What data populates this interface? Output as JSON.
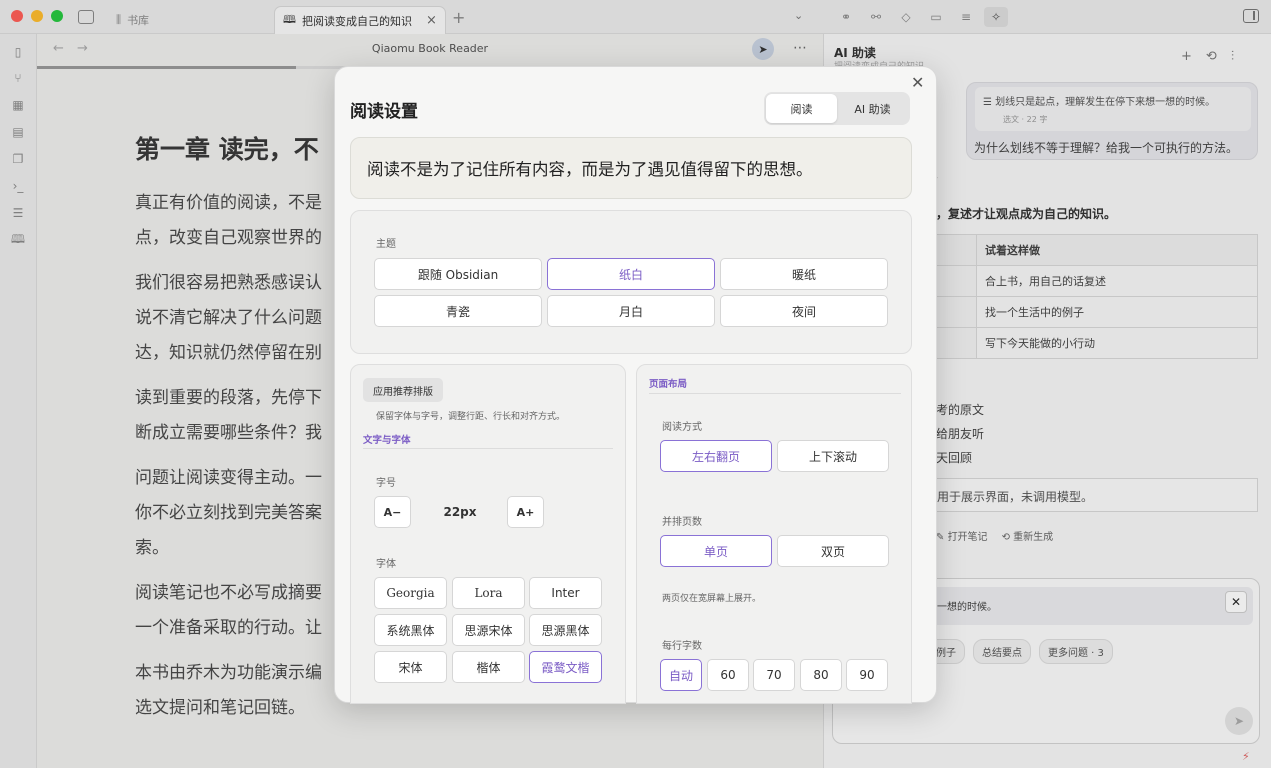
{
  "titlebar": {
    "tabs": [
      {
        "icon": "library-icon",
        "label": "书库",
        "active": false
      },
      {
        "icon": "book-open-icon",
        "label": "把阅读变成自己的知识",
        "active": true
      }
    ],
    "close_glyph": "×",
    "new_tab_glyph": "+"
  },
  "main": {
    "title": "Qiaomu Book Reader",
    "progress": 0.33,
    "chapter_title": "第一章 读完，不",
    "paragraphs": [
      "真正有价值的阅读，不是\n点，改变自己观察世界的",
      "我们很容易把熟悉感误认\n说不清它解决了什么问题\n达，知识就仍然停留在别",
      "读到重要的段落，先停下\n断成立需要哪些条件？我",
      "问题让阅读变得主动。一\n你不必立刻找到完美答案\n索。",
      "阅读笔记也不必写成摘要\n一个准备采取的行动。让",
      "本书由乔木为功能演示编\n选文提问和笔记回链。"
    ]
  },
  "ai_panel": {
    "title": "AI 助读",
    "subtitle": "把阅读变成自己的知识",
    "quote": {
      "text": "划线只是起点，理解发生在停下来想一想的时候。",
      "meta": "选文 · 22 字",
      "question": "为什么划线不等于理解？给我一个可执行的方法。"
    },
    "answer_tag": "”",
    "answer_lead": "，复述才让观点成为自己的知识。",
    "table": {
      "header": [
        "",
        "试着这样做"
      ],
      "rows": [
        [
          "",
          "合上书，用自己的话复述"
        ],
        [
          "",
          "找一个生活中的例子"
        ],
        [
          "",
          "写下今天能做的小行动"
        ]
      ]
    },
    "list": [
      "考的原文",
      "给朋友听",
      "天回顾"
    ],
    "note": "用于展示界面，未调用模型。",
    "actions": [
      "打开笔记",
      "重新生成"
    ],
    "composer": {
      "quote": "理解发生在停下来想一想的时候。",
      "chips": [
        "例子",
        "总结要点",
        "更多问题 · 3"
      ]
    }
  },
  "modal": {
    "title": "阅读设置",
    "mode_tabs": [
      {
        "label": "阅读",
        "selected": true
      },
      {
        "label": "AI 助读",
        "selected": false
      }
    ],
    "preview_text": "阅读不是为了记住所有内容，而是为了遇见值得留下的思想。",
    "theme": {
      "label": "主题",
      "options": [
        "跟随 Obsidian",
        "纸白",
        "暖纸",
        "青瓷",
        "月白",
        "夜间"
      ],
      "selected": "纸白"
    },
    "typography": {
      "apply_button": "应用推荐排版",
      "apply_hint": "保留字体与字号，调整行距、行长和对齐方式。",
      "section": "文字与字体",
      "size_label": "字号",
      "decrease": "A−",
      "size_value": "22px",
      "increase": "A+",
      "font_label": "字体",
      "fonts": [
        "Georgia",
        "Lora",
        "Inter",
        "系统黑体",
        "思源宋体",
        "思源黑体",
        "宋体",
        "楷体",
        "霞鹜文楷"
      ],
      "selected_font": "霞鹜文楷"
    },
    "layout": {
      "section": "页面布局",
      "mode_label": "阅读方式",
      "modes": [
        "左右翻页",
        "上下滚动"
      ],
      "selected_mode": "左右翻页",
      "pages_label": "并排页数",
      "pages": [
        "单页",
        "双页"
      ],
      "selected_pages": "单页",
      "pages_hint": "两页仅在宽屏幕上展开。",
      "chars_label": "每行字数",
      "chars": [
        "自动",
        "60",
        "70",
        "80",
        "90"
      ],
      "selected_chars": "自动"
    }
  },
  "colors": {
    "accent": "#7b5cc5",
    "selected_border": "#8a72d6"
  }
}
